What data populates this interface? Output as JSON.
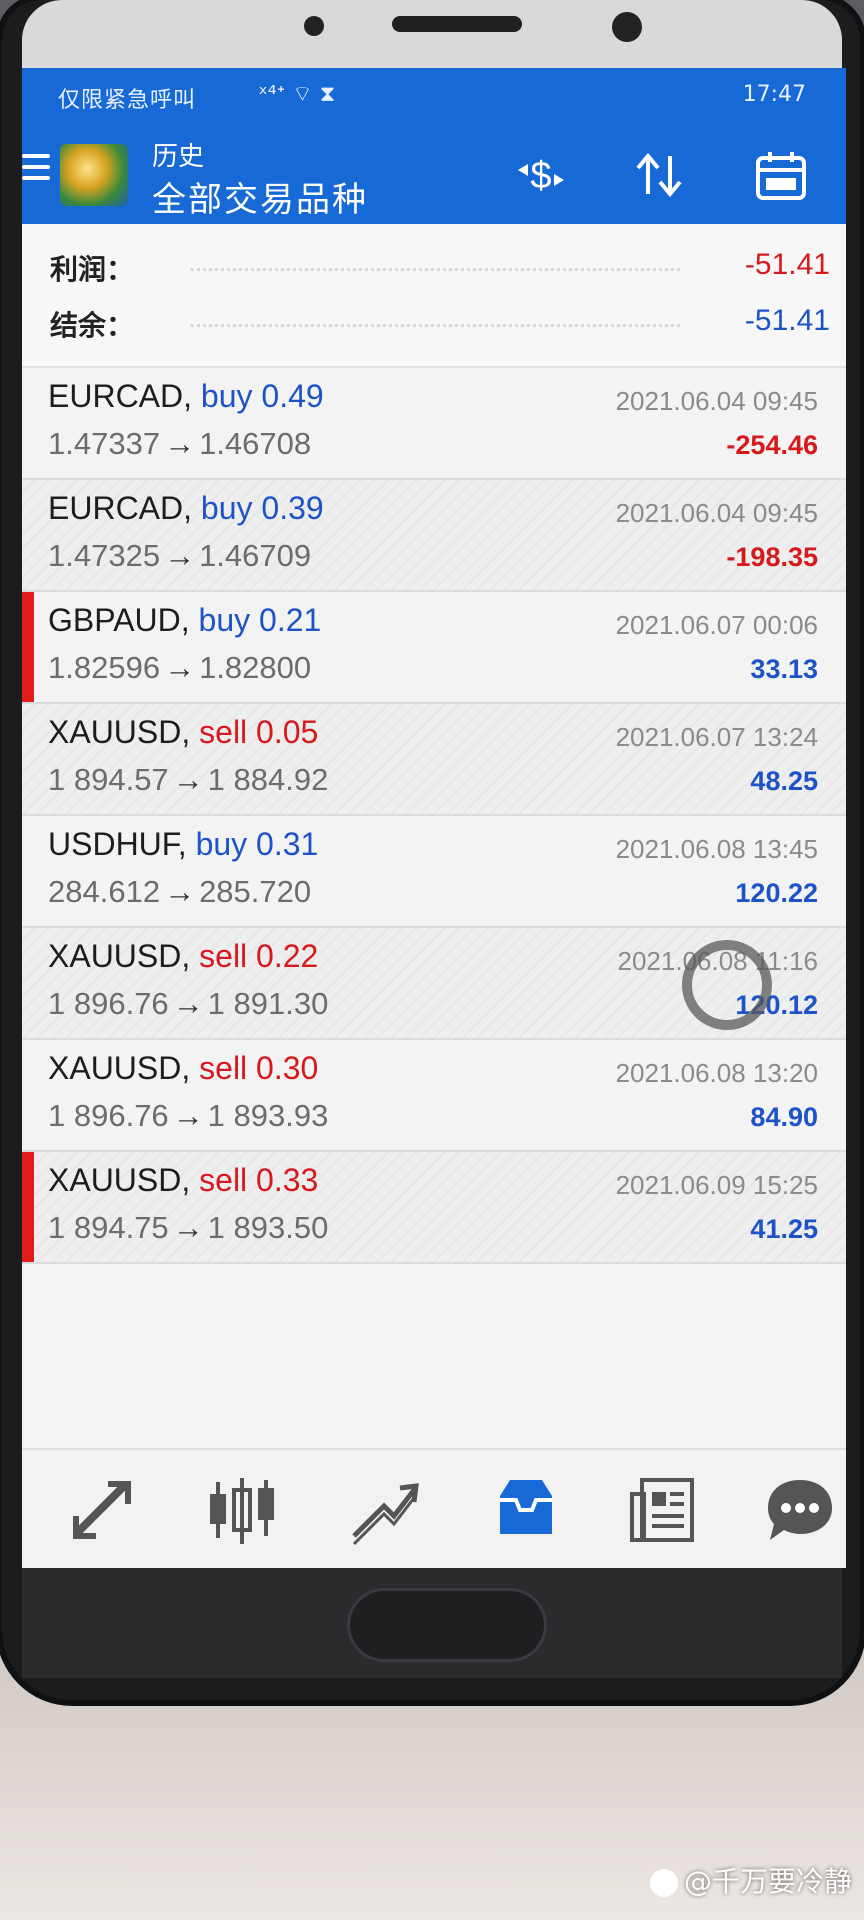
{
  "status_bar": {
    "carrier": "仅限紧急呼叫",
    "icons": "ˣ⁴ᐩ  ⌔  ⧗",
    "time": "17:47"
  },
  "app_bar": {
    "subtitle": "历史",
    "title": "全部交易品种",
    "icons": [
      "menu-icon",
      "currency-exchange-icon",
      "sort-icon",
      "calendar-icon"
    ]
  },
  "summary": {
    "profit_label": "利润：",
    "profit_value": "-51.41",
    "balance_label": "结余：",
    "balance_value": "-51.41"
  },
  "trades": [
    {
      "symbol": "EURCAD",
      "side": "buy",
      "volume": "0.49",
      "open": "1.47337",
      "close": "1.46708",
      "time": "2021.06.04 09:45",
      "profit": "-254.46",
      "profit_sign": "neg",
      "marker": false
    },
    {
      "symbol": "EURCAD",
      "side": "buy",
      "volume": "0.39",
      "open": "1.47325",
      "close": "1.46709",
      "time": "2021.06.04 09:45",
      "profit": "-198.35",
      "profit_sign": "neg",
      "marker": false
    },
    {
      "symbol": "GBPAUD",
      "side": "buy",
      "volume": "0.21",
      "open": "1.82596",
      "close": "1.82800",
      "time": "2021.06.07 00:06",
      "profit": "33.13",
      "profit_sign": "pos",
      "marker": true
    },
    {
      "symbol": "XAUUSD",
      "side": "sell",
      "volume": "0.05",
      "open": "1 894.57",
      "close": "1 884.92",
      "time": "2021.06.07 13:24",
      "profit": "48.25",
      "profit_sign": "pos",
      "marker": false
    },
    {
      "symbol": "USDHUF",
      "side": "buy",
      "volume": "0.31",
      "open": "284.612",
      "close": "285.720",
      "time": "2021.06.08 13:45",
      "profit": "120.22",
      "profit_sign": "pos",
      "marker": false
    },
    {
      "symbol": "XAUUSD",
      "side": "sell",
      "volume": "0.22",
      "open": "1 896.76",
      "close": "1 891.30",
      "time": "2021.06.08 11:16",
      "profit": "120.12",
      "profit_sign": "pos",
      "marker": false
    },
    {
      "symbol": "XAUUSD",
      "side": "sell",
      "volume": "0.30",
      "open": "1 896.76",
      "close": "1 893.93",
      "time": "2021.06.08 13:20",
      "profit": "84.90",
      "profit_sign": "pos",
      "marker": false
    },
    {
      "symbol": "XAUUSD",
      "side": "sell",
      "volume": "0.33",
      "open": "1 894.75",
      "close": "1 893.50",
      "time": "2021.06.09 15:25",
      "profit": "41.25",
      "profit_sign": "pos",
      "marker": true
    }
  ],
  "bottom_nav": [
    "quotes-icon",
    "chart-icon",
    "trade-icon",
    "history-icon",
    "news-icon",
    "chat-icon"
  ],
  "active_nav": "history-icon",
  "colors": {
    "accent": "#1769d6",
    "buy": "#1d52c8",
    "sell": "#d7191c"
  },
  "watermark": "@千万要冷静"
}
